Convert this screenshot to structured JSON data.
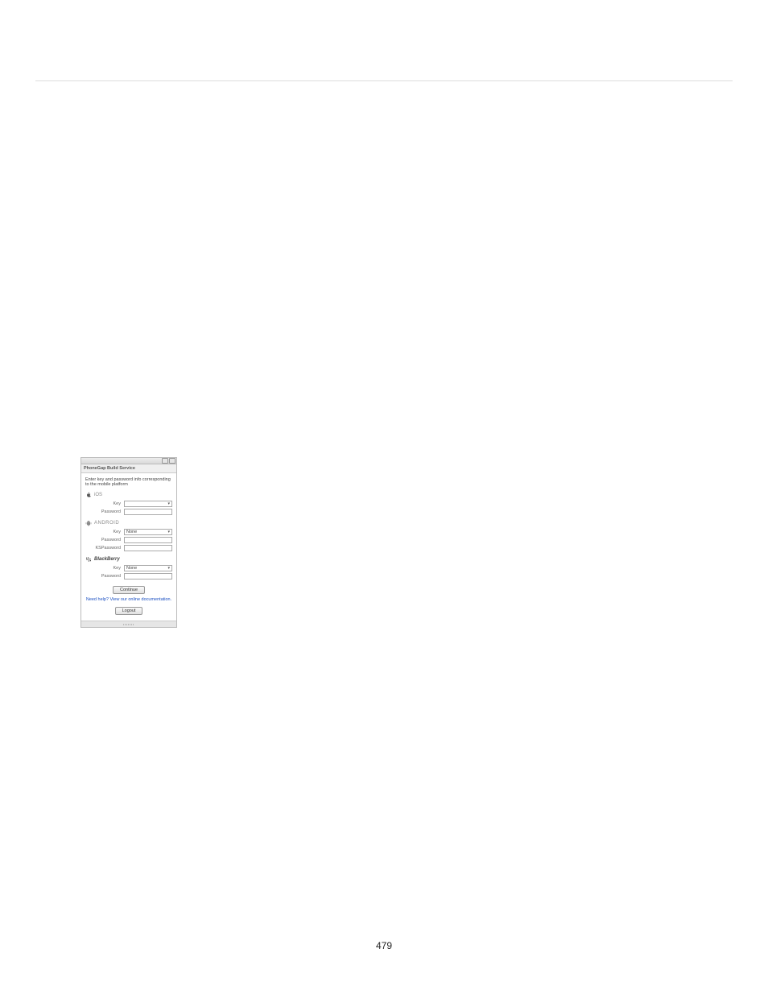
{
  "page_number": "479",
  "dialog": {
    "tab_title": "PhoneGap Build Service",
    "instruction": "Enter key and password info corresponding to the mobile platform",
    "labels": {
      "key": "Key",
      "password": "Password",
      "ks_password": "KSPassword"
    },
    "platforms": {
      "ios": {
        "name": "iOS",
        "key_selected": ""
      },
      "android": {
        "name": "android",
        "key_selected": "None"
      },
      "blackberry": {
        "name": "BlackBerry",
        "key_selected": "None"
      }
    },
    "continue_label": "Continue",
    "help_text": "Need help? View our online documentation.",
    "logout_label": "Logout"
  }
}
